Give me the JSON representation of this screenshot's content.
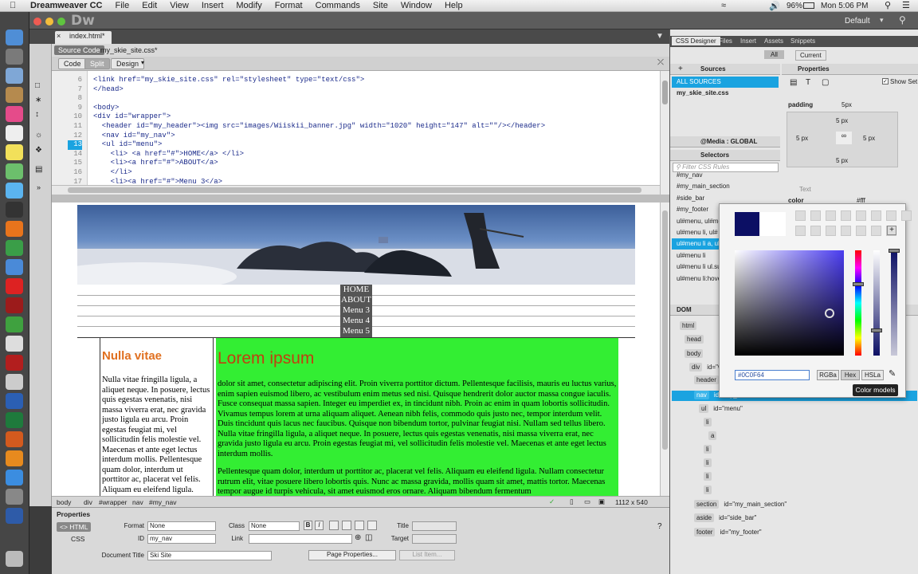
{
  "menubar": {
    "app_name": "Dreamweaver CC",
    "items": [
      "File",
      "Edit",
      "View",
      "Insert",
      "Modify",
      "Format",
      "Commands",
      "Site",
      "Window",
      "Help"
    ],
    "battery": "96%",
    "clock": "Mon 5:06 PM"
  },
  "app": {
    "logo": "Dw",
    "workspace": "Default"
  },
  "document": {
    "tab": "index.html*",
    "related_files": [
      "Source Code",
      "my_skie_site.css*"
    ],
    "views": [
      "Code",
      "Split",
      "Design"
    ]
  },
  "code_lines": [
    {
      "num": "6",
      "text": "<link href=\"my_skie_site.css\" rel=\"stylesheet\" type=\"text/css\">"
    },
    {
      "num": "7",
      "text": "</head>"
    },
    {
      "num": "8",
      "text": ""
    },
    {
      "num": "9",
      "text": "<body>"
    },
    {
      "num": "10",
      "text": "<div id=\"wrapper\">"
    },
    {
      "num": "11",
      "text": "  <header id=\"my_header\"><img src=\"images/Wiiskii_banner.jpg\" width=\"1020\" height=\"147\" alt=\"\"/></header>"
    },
    {
      "num": "12",
      "text": "  <nav id=\"my_nav\">"
    },
    {
      "num": "13",
      "text": "  <ul id=\"menu\">"
    },
    {
      "num": "14",
      "text": "    <li> <a href=\"#\">HOME</a> </li>"
    },
    {
      "num": "15",
      "text": "    <li><a href=\"#\">ABOUT</a>"
    },
    {
      "num": "16",
      "text": "    </li>"
    },
    {
      "num": "17",
      "text": "    <li><a href=\"#\">Menu 3</a>"
    }
  ],
  "design_view": {
    "nav_items": [
      "HOME",
      "ABOUT",
      "Menu 3",
      "Menu 4",
      "Menu 5"
    ],
    "side_title": "Nulla vitae",
    "side_text": "Nulla vitae fringilla ligula, a aliquet neque. In posuere, lectus quis egestas venenatis, nisi massa viverra erat, nec gravida justo ligula eu arcu. Proin egestas feugiat mi, vel sollicitudin felis molestie vel. Maecenas et ante eget lectus interdum mollis. Pellentesque quam dolor, interdum ut porttitor ac, placerat vel felis. Aliquam eu eleifend ligula.",
    "main_title": "Lorem ipsum",
    "main_p1": "dolor sit amet, consectetur adipiscing elit. Proin viverra porttitor dictum. Pellentesque facilisis, mauris eu luctus varius, enim sapien euismod libero, ac vestibulum enim metus sed nisi. Quisque hendrerit dolor auctor massa congue iaculis. Fusce consequat massa sapien. Integer eu imperdiet ex, in tincidunt nibh. Proin ac enim in quam lobortis sollicitudin. Vivamus tempus lorem at urna aliquam aliquet. Aenean nibh felis, commodo quis justo nec, tempor interdum velit. Duis tincidunt quis lacus nec faucibus. Quisque non bibendum tortor, pulvinar feugiat nisi. Nullam sed tellus libero. Nulla vitae fringilla ligula, a aliquet neque. In posuere, lectus quis egestas venenatis, nisi massa viverra erat, nec gravida justo ligula eu arcu. Proin egestas feugiat mi, vel sollicitudin felis molestie vel. Maecenas et ante eget lectus interdum mollis.",
    "main_p2": "Pellentesque quam dolor, interdum ut porttitor ac, placerat vel felis. Aliquam eu eleifend ligula. Nullam consectetur rutrum elit, vitae posuere libero lobortis quis. Nunc ac massa gravida, mollis quam sit amet, mattis tortor. Maecenas tempor augue id turpis vehicula, sit amet euismod eros ornare. Aliquam bibendum fermentum"
  },
  "status_bar": {
    "tags": [
      "body",
      "div",
      "#wrapper",
      "nav",
      "#my_nav"
    ],
    "size": "1112 x 540"
  },
  "properties": {
    "title": "Properties",
    "html_label": "HTML",
    "css_label": "CSS",
    "format_label": "Format",
    "format_value": "None",
    "class_label": "Class",
    "class_value": "None",
    "id_label": "ID",
    "id_value": "my_nav",
    "link_label": "Link",
    "title_label": "Title",
    "target_label": "Target",
    "doc_title_label": "Document Title",
    "doc_title_value": "Ski Site",
    "page_props_btn": "Page Properties...",
    "list_item_btn": "List Item..."
  },
  "right_panel": {
    "tabs": [
      "CSS Designer",
      "Files",
      "Insert",
      "Assets",
      "Snippets"
    ],
    "mode": [
      "All",
      "Current"
    ],
    "sources_header": "Sources",
    "properties_header": "Properties",
    "all_sources": "ALL SOURCES",
    "css_file": "my_skie_site.css",
    "show_set": "Show Set",
    "media_header": "@Media : GLOBAL",
    "selectors_header": "Selectors",
    "filter_placeholder": "Filter CSS Rules",
    "selectors": [
      "#my_nav",
      "#my_main_section",
      "#side_bar",
      "#my_footer",
      "ul#menu, ul#me",
      "ul#menu li, ul#",
      "ul#menu li a, ul",
      "ul#menu li",
      "ul#menu li ul.su",
      "ul#menu li:hove"
    ],
    "selected_selector_index": 6,
    "padding_label": "padding",
    "padding_value": "5px",
    "padding_top": "5 px",
    "padding_left": "5 px",
    "padding_right": "5 px",
    "padding_bottom": "5 px",
    "text_section": "Text",
    "color_label": "color",
    "color_value": "#fff",
    "dom_header": "DOM"
  },
  "dom_tree": [
    {
      "tag": "html",
      "attr": "",
      "indent": 0
    },
    {
      "tag": "head",
      "attr": "",
      "indent": 1
    },
    {
      "tag": "body",
      "attr": "",
      "indent": 1
    },
    {
      "tag": "div",
      "attr": "id=\"w",
      "indent": 2
    },
    {
      "tag": "header",
      "attr": "",
      "indent": 3
    },
    {
      "tag": "nav",
      "attr": "id=\"my_nav\"",
      "indent": 3,
      "selected": true
    },
    {
      "tag": "ul",
      "attr": "id=\"menu\"",
      "indent": 4
    },
    {
      "tag": "li",
      "attr": "",
      "indent": 5
    },
    {
      "tag": "a",
      "attr": "",
      "indent": 6
    },
    {
      "tag": "li",
      "attr": "",
      "indent": 5
    },
    {
      "tag": "li",
      "attr": "",
      "indent": 5
    },
    {
      "tag": "li",
      "attr": "",
      "indent": 5
    },
    {
      "tag": "li",
      "attr": "",
      "indent": 5
    },
    {
      "tag": "section",
      "attr": "id=\"my_main_section\"",
      "indent": 3
    },
    {
      "tag": "aside",
      "attr": "id=\"side_bar\"",
      "indent": 3
    },
    {
      "tag": "footer",
      "attr": "id=\"my_footer\"",
      "indent": 3
    }
  ],
  "color_picker": {
    "hex_value": "#0C0F64",
    "mode_buttons": [
      "RGBa",
      "Hex",
      "HSLa"
    ],
    "selected_mode": "Hex",
    "current_color": "#0c0f64",
    "tooltip": "Color models"
  },
  "colors": {
    "accent": "#1aa3e0",
    "main_bg": "#33ee33",
    "title_orange": "#e07020"
  }
}
